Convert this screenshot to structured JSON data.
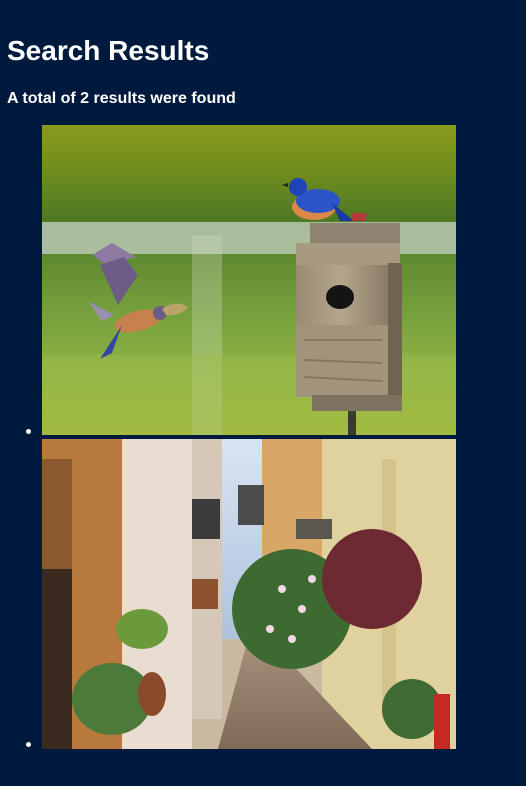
{
  "page": {
    "title": "Search Results",
    "summary": "A total of 2 results were found"
  },
  "results": [
    {
      "image": "bluebirds-birdhouse-photo"
    },
    {
      "image": "narrow-street-flowers-photo"
    }
  ],
  "colors": {
    "background": "#001a3d",
    "text": "#ffffff"
  }
}
